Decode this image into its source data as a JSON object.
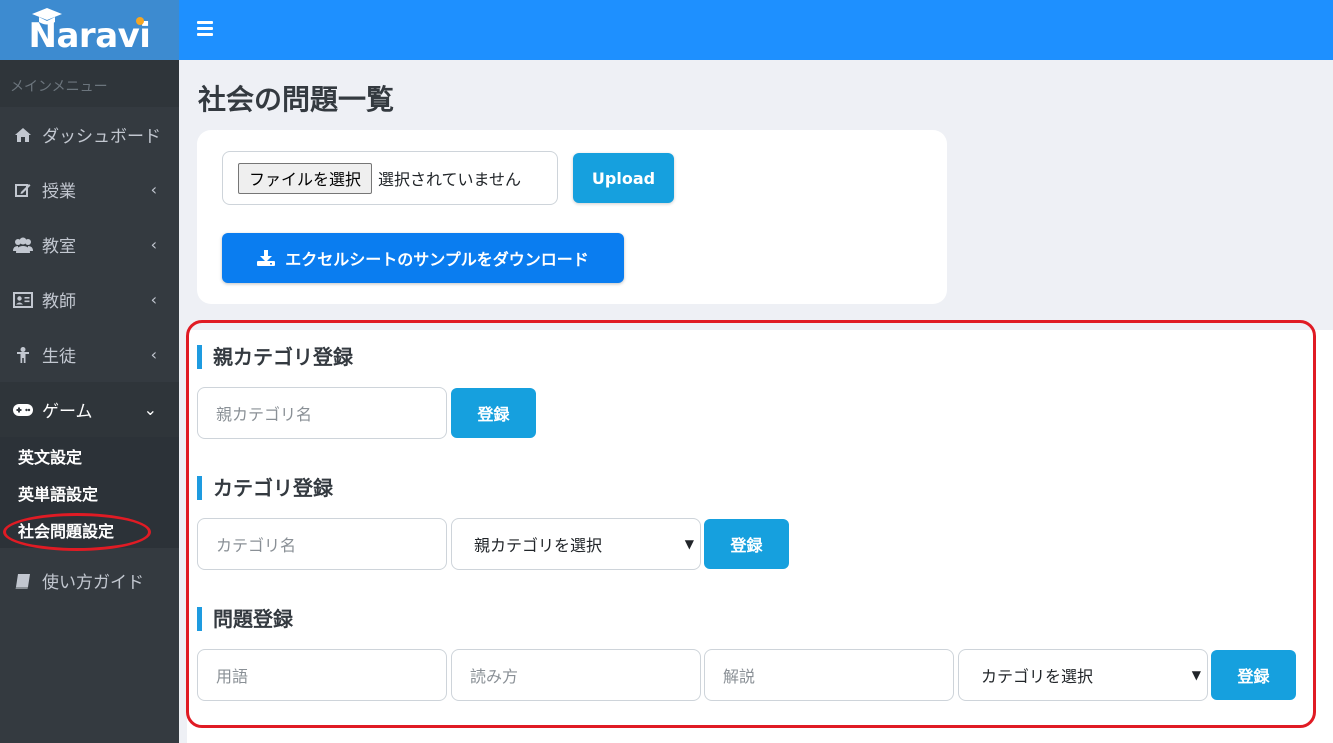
{
  "brand": {
    "name": "Naravi"
  },
  "sidebar": {
    "header": "メインメニュー",
    "items": [
      {
        "label": "ダッシュボード",
        "icon": "home-icon"
      },
      {
        "label": "授業",
        "icon": "edit-icon"
      },
      {
        "label": "教室",
        "icon": "users-icon"
      },
      {
        "label": "教師",
        "icon": "id-card-icon"
      },
      {
        "label": "生徒",
        "icon": "child-icon"
      },
      {
        "label": "ゲーム",
        "icon": "gamepad-icon"
      }
    ],
    "game_submenu": [
      "英文設定",
      "英単語設定",
      "社会問題設定"
    ],
    "guide": {
      "label": "使い方ガイド",
      "icon": "book-icon"
    }
  },
  "page": {
    "title": "社会の問題一覧"
  },
  "upload": {
    "file_button": "ファイルを選択",
    "file_status": "選択されていません",
    "upload_label": "Upload",
    "download_label": "エクセルシートのサンプルをダウンロード"
  },
  "parent_category": {
    "title": "親カテゴリ登録",
    "name_placeholder": "親カテゴリ名",
    "button": "登録"
  },
  "category": {
    "title": "カテゴリ登録",
    "name_placeholder": "カテゴリ名",
    "parent_select": "親カテゴリを選択",
    "button": "登録"
  },
  "question": {
    "title": "問題登録",
    "term_placeholder": "用語",
    "reading_placeholder": "読み方",
    "explanation_placeholder": "解説",
    "category_select": "カテゴリを選択",
    "button": "登録"
  },
  "colors": {
    "sidebar": "#343a40",
    "topbar": "#1e90ff",
    "primary_button": "#16a0de",
    "download_button": "#0a7df0",
    "highlight": "#e01b24"
  }
}
